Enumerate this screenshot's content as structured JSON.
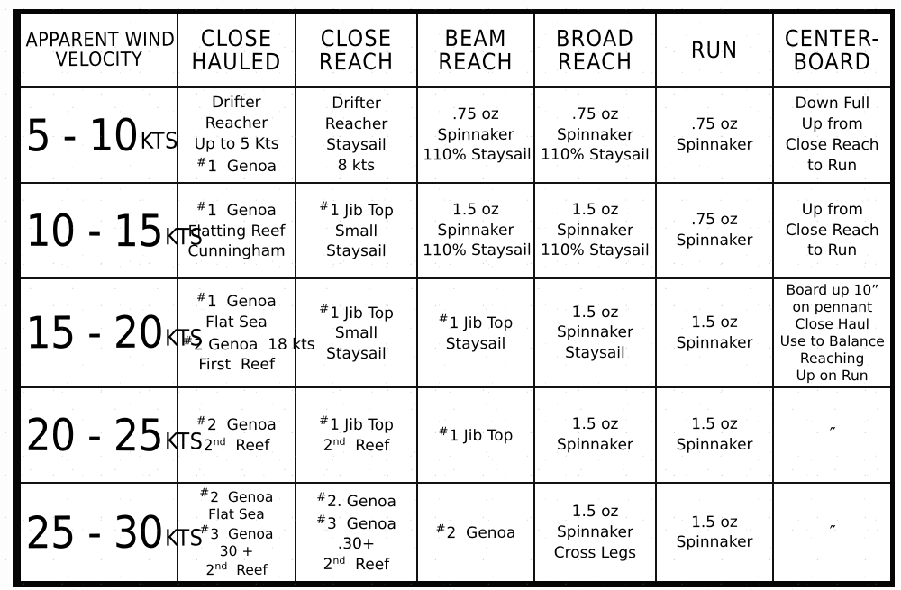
{
  "document": {
    "kind": "handwritten-sail-selection-chart"
  },
  "table": {
    "headers": [
      {
        "name": "apparent-wind-velocity",
        "lines": [
          "APPARENT WIND",
          "VELOCITY"
        ]
      },
      {
        "name": "close-hauled",
        "lines": [
          "CLOSE",
          "HAULED"
        ]
      },
      {
        "name": "close-reach",
        "lines": [
          "CLOSE",
          "REACH"
        ]
      },
      {
        "name": "beam-reach",
        "lines": [
          "BEAM",
          "REACH"
        ]
      },
      {
        "name": "broad-reach",
        "lines": [
          "BROAD",
          "REACH"
        ]
      },
      {
        "name": "run",
        "lines": [
          "RUN"
        ]
      },
      {
        "name": "centerboard",
        "lines": [
          "CENTER-",
          "BOARD"
        ]
      }
    ],
    "rows": [
      {
        "velocity": {
          "range": "5 - 10",
          "unit": "KTS"
        },
        "close_hauled": [
          "Drifter",
          "Reacher",
          "Up to 5 Kts",
          "#1  Genoa"
        ],
        "close_reach": [
          "Drifter",
          "Reacher",
          "Staysail",
          "8 kts"
        ],
        "beam_reach": [
          ".75 oz",
          "Spinnaker",
          "110% Staysail"
        ],
        "broad_reach": [
          ".75 oz",
          "Spinnaker",
          "110% Staysail"
        ],
        "run": [
          ".75 oz",
          "Spinnaker"
        ],
        "centerboard": [
          "Down Full",
          "Up from",
          "Close Reach",
          "to Run"
        ]
      },
      {
        "velocity": {
          "range": "10 - 15",
          "unit": "KTS"
        },
        "close_hauled": [
          "#1  Genoa",
          "Flatting Reef",
          "Cunningham"
        ],
        "close_reach": [
          "#1 Jib Top",
          "Small",
          "Staysail"
        ],
        "beam_reach": [
          "1.5 oz",
          "Spinnaker",
          "110% Staysail"
        ],
        "broad_reach": [
          "1.5 oz",
          "Spinnaker",
          "110% Staysail"
        ],
        "run": [
          ".75 oz",
          "Spinnaker"
        ],
        "centerboard": [
          "Up from",
          "Close Reach",
          "to Run"
        ]
      },
      {
        "velocity": {
          "range": "15 - 20",
          "unit": "KTS"
        },
        "close_hauled": [
          "#1  Genoa",
          "Flat Sea",
          "#2 Genoa  18 kts",
          "First  Reef"
        ],
        "close_reach": [
          "#1 Jib Top",
          "Small",
          "Staysail"
        ],
        "beam_reach": [
          "#1 Jib Top",
          "Staysail"
        ],
        "broad_reach": [
          "1.5 oz",
          "Spinnaker",
          "Staysail"
        ],
        "run": [
          "1.5 oz",
          "Spinnaker"
        ],
        "centerboard": [
          "Board up 10”",
          "on pennant",
          "Close Haul",
          "Use to Balance",
          "Reaching",
          "Up on Run"
        ]
      },
      {
        "velocity": {
          "range": "20 - 25",
          "unit": "KTS"
        },
        "close_hauled": [
          "#2  Genoa",
          "2nd  Reef"
        ],
        "close_reach": [
          "#1 Jib Top",
          "2nd  Reef"
        ],
        "beam_reach": [
          "#1 Jib Top"
        ],
        "broad_reach": [
          "1.5 oz",
          "Spinnaker"
        ],
        "run": [
          "1.5 oz",
          "Spinnaker"
        ],
        "centerboard": [
          "″"
        ]
      },
      {
        "velocity": {
          "range": "25 - 30",
          "unit": "KTS"
        },
        "close_hauled": [
          "#2  Genoa",
          "Flat Sea",
          "#3  Genoa",
          "30 +",
          "2nd  Reef"
        ],
        "close_reach": [
          "#2. Genoa",
          "#3  Genoa",
          ".30+",
          "2nd  Reef"
        ],
        "beam_reach": [
          "#2  Genoa"
        ],
        "broad_reach": [
          "1.5 oz",
          "Spinnaker",
          "Cross Legs"
        ],
        "run": [
          "1.5 oz",
          "Spinnaker"
        ],
        "centerboard": [
          "″"
        ]
      }
    ]
  },
  "colors": {
    "ink": "#0a0a0a",
    "paper": "#ffffff",
    "frame": "#050505"
  }
}
